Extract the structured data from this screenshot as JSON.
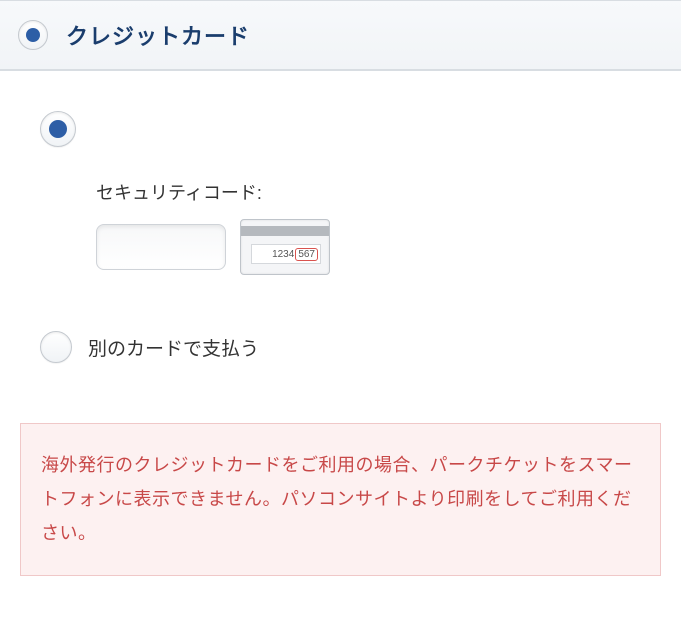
{
  "header": {
    "title": "クレジットカード"
  },
  "savedCard": {
    "securityLabel": "セキュリティコード:",
    "securityValue": "",
    "cvvIcon": {
      "digitsLeft": "1234",
      "digitsHighlight": "567"
    }
  },
  "otherCard": {
    "label": "別のカードで支払う"
  },
  "notice": {
    "text": "海外発行のクレジットカードをご利用の場合、パークチケットをスマートフォンに表示できません。パソコンサイトより印刷をしてご利用ください。"
  }
}
